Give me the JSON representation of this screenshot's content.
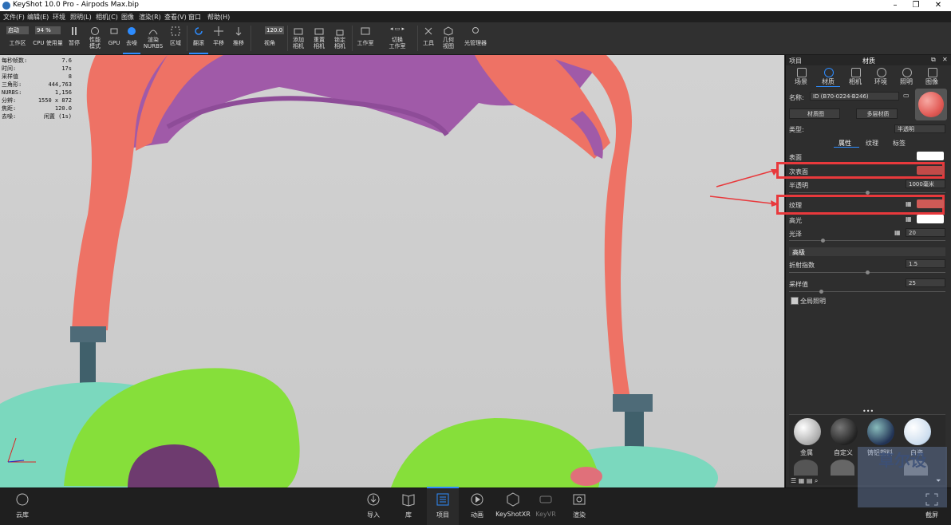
{
  "window": {
    "title": "KeyShot 10.0 Pro  -  Airpods Max.bip",
    "minimize": "–",
    "maximize": "❐",
    "close": "✕"
  },
  "menu": [
    "文件(F)",
    "编辑(E)",
    "环境",
    "照明(L)",
    "相机(C)",
    "图像",
    "渲染(R)",
    "查看(V)",
    "窗口",
    "帮助(H)"
  ],
  "toolbar": {
    "mode_value": "启动",
    "zoom_value": "94 %",
    "fov_value": "120.0",
    "buttons": [
      {
        "label": "工作区",
        "icon": "workspace-icon"
      },
      {
        "label": "CPU 使用量",
        "icon": "cpu-icon"
      },
      {
        "label": "暂停",
        "icon": "pause-icon"
      },
      {
        "label": "性能\n模式",
        "icon": "performance-icon"
      },
      {
        "label": "GPU",
        "icon": "gpu-icon"
      },
      {
        "label": "去噪",
        "icon": "denoise-icon"
      },
      {
        "label": "渲染\nNURBS",
        "icon": "nurbs-icon"
      },
      {
        "label": "区域",
        "icon": "region-icon"
      },
      {
        "label": "翻滚",
        "icon": "tumble-icon"
      },
      {
        "label": "平移",
        "icon": "pan-icon"
      },
      {
        "label": "推移",
        "icon": "dolly-icon"
      },
      {
        "label": "视角",
        "icon": "view-angle-icon"
      },
      {
        "label": "添加\n相机",
        "icon": "add-camera-icon"
      },
      {
        "label": "重置\n相机",
        "icon": "reset-camera-icon"
      },
      {
        "label": "锁定\n相机",
        "icon": "lock-camera-icon"
      },
      {
        "label": "工作室",
        "icon": "studio-icon"
      },
      {
        "label": "切换\n工作室",
        "icon": "switch-studio-icon"
      },
      {
        "label": "工具",
        "icon": "tools-icon"
      },
      {
        "label": "几何\n视图",
        "icon": "geometry-view-icon"
      },
      {
        "label": "光管理器",
        "icon": "light-manager-icon"
      }
    ]
  },
  "stats": [
    {
      "label": "每秒帧数:",
      "value": "7.6"
    },
    {
      "label": "时间:",
      "value": "17s"
    },
    {
      "label": "采样值",
      "value": "8"
    },
    {
      "label": "三角形:",
      "value": "444,763"
    },
    {
      "label": "NURBS:",
      "value": "1,156"
    },
    {
      "label": "分辨:",
      "value": "1550 x 872"
    },
    {
      "label": "焦距:",
      "value": "120.0"
    },
    {
      "label": "去噪:",
      "value": "闲置 (1s)"
    }
  ],
  "panel": {
    "header_left": "项目",
    "header_title": "材质",
    "tabs": [
      "场景",
      "材质",
      "相机",
      "环境",
      "照明",
      "图像"
    ],
    "name_label": "名称:",
    "name_value": "ID (B70-0224-B246)",
    "material_graph": "材质图",
    "multi_material": "多层材质",
    "type_label": "类型:",
    "type_value": "半透明",
    "subtabs": [
      "属性",
      "纹理",
      "标签"
    ],
    "props": {
      "surface": "表面",
      "subsurface": "次表面",
      "translucency": "半透明",
      "translucency_value": "1000毫米",
      "texture": "纹理",
      "specular": "高光",
      "roughness": "光泽",
      "roughness_value": "20",
      "advanced": "高级",
      "ior": "折射指数",
      "ior_value": "1.5",
      "samples": "采样值",
      "samples_value": "25",
      "global_illum": "全局照明"
    },
    "colors": {
      "surface": "#ffffff",
      "subsurface": "#c24a48",
      "texture": "#cf5a56",
      "specular": "#ffffff",
      "preview": "#e25c57"
    },
    "library": [
      "金属",
      "自定义",
      "铸铝塑料",
      "白瓷"
    ]
  },
  "bottom": {
    "cloud": "云库",
    "items": [
      {
        "label": "导入",
        "icon": "import-icon"
      },
      {
        "label": "库",
        "icon": "library-icon"
      },
      {
        "label": "项目",
        "icon": "project-icon"
      },
      {
        "label": "动画",
        "icon": "animation-icon"
      },
      {
        "label": "KeyShotXR",
        "icon": "keyshotxr-icon"
      },
      {
        "label": "KeyVR",
        "icon": "keyvr-icon"
      },
      {
        "label": "渲染",
        "icon": "render-icon"
      }
    ],
    "screenshot": "截屏"
  },
  "watermark": "草尔设"
}
